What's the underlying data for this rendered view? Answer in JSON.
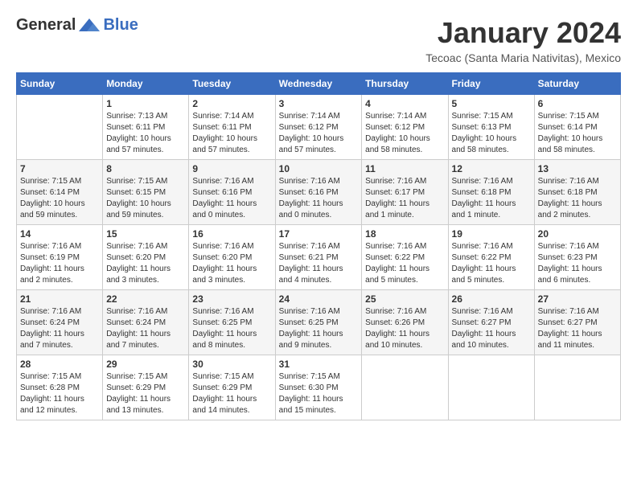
{
  "header": {
    "logo": {
      "general": "General",
      "blue": "Blue"
    },
    "title": "January 2024",
    "location": "Tecoac (Santa Maria Nativitas), Mexico"
  },
  "weekdays": [
    "Sunday",
    "Monday",
    "Tuesday",
    "Wednesday",
    "Thursday",
    "Friday",
    "Saturday"
  ],
  "weeks": [
    [
      {
        "day": "",
        "info": ""
      },
      {
        "day": "1",
        "info": "Sunrise: 7:13 AM\nSunset: 6:11 PM\nDaylight: 10 hours and 57 minutes."
      },
      {
        "day": "2",
        "info": "Sunrise: 7:14 AM\nSunset: 6:11 PM\nDaylight: 10 hours and 57 minutes."
      },
      {
        "day": "3",
        "info": "Sunrise: 7:14 AM\nSunset: 6:12 PM\nDaylight: 10 hours and 57 minutes."
      },
      {
        "day": "4",
        "info": "Sunrise: 7:14 AM\nSunset: 6:12 PM\nDaylight: 10 hours and 58 minutes."
      },
      {
        "day": "5",
        "info": "Sunrise: 7:15 AM\nSunset: 6:13 PM\nDaylight: 10 hours and 58 minutes."
      },
      {
        "day": "6",
        "info": "Sunrise: 7:15 AM\nSunset: 6:14 PM\nDaylight: 10 hours and 58 minutes."
      }
    ],
    [
      {
        "day": "7",
        "info": "Sunrise: 7:15 AM\nSunset: 6:14 PM\nDaylight: 10 hours and 59 minutes."
      },
      {
        "day": "8",
        "info": "Sunrise: 7:15 AM\nSunset: 6:15 PM\nDaylight: 10 hours and 59 minutes."
      },
      {
        "day": "9",
        "info": "Sunrise: 7:16 AM\nSunset: 6:16 PM\nDaylight: 11 hours and 0 minutes."
      },
      {
        "day": "10",
        "info": "Sunrise: 7:16 AM\nSunset: 6:16 PM\nDaylight: 11 hours and 0 minutes."
      },
      {
        "day": "11",
        "info": "Sunrise: 7:16 AM\nSunset: 6:17 PM\nDaylight: 11 hours and 1 minute."
      },
      {
        "day": "12",
        "info": "Sunrise: 7:16 AM\nSunset: 6:18 PM\nDaylight: 11 hours and 1 minute."
      },
      {
        "day": "13",
        "info": "Sunrise: 7:16 AM\nSunset: 6:18 PM\nDaylight: 11 hours and 2 minutes."
      }
    ],
    [
      {
        "day": "14",
        "info": "Sunrise: 7:16 AM\nSunset: 6:19 PM\nDaylight: 11 hours and 2 minutes."
      },
      {
        "day": "15",
        "info": "Sunrise: 7:16 AM\nSunset: 6:20 PM\nDaylight: 11 hours and 3 minutes."
      },
      {
        "day": "16",
        "info": "Sunrise: 7:16 AM\nSunset: 6:20 PM\nDaylight: 11 hours and 3 minutes."
      },
      {
        "day": "17",
        "info": "Sunrise: 7:16 AM\nSunset: 6:21 PM\nDaylight: 11 hours and 4 minutes."
      },
      {
        "day": "18",
        "info": "Sunrise: 7:16 AM\nSunset: 6:22 PM\nDaylight: 11 hours and 5 minutes."
      },
      {
        "day": "19",
        "info": "Sunrise: 7:16 AM\nSunset: 6:22 PM\nDaylight: 11 hours and 5 minutes."
      },
      {
        "day": "20",
        "info": "Sunrise: 7:16 AM\nSunset: 6:23 PM\nDaylight: 11 hours and 6 minutes."
      }
    ],
    [
      {
        "day": "21",
        "info": "Sunrise: 7:16 AM\nSunset: 6:24 PM\nDaylight: 11 hours and 7 minutes."
      },
      {
        "day": "22",
        "info": "Sunrise: 7:16 AM\nSunset: 6:24 PM\nDaylight: 11 hours and 7 minutes."
      },
      {
        "day": "23",
        "info": "Sunrise: 7:16 AM\nSunset: 6:25 PM\nDaylight: 11 hours and 8 minutes."
      },
      {
        "day": "24",
        "info": "Sunrise: 7:16 AM\nSunset: 6:25 PM\nDaylight: 11 hours and 9 minutes."
      },
      {
        "day": "25",
        "info": "Sunrise: 7:16 AM\nSunset: 6:26 PM\nDaylight: 11 hours and 10 minutes."
      },
      {
        "day": "26",
        "info": "Sunrise: 7:16 AM\nSunset: 6:27 PM\nDaylight: 11 hours and 10 minutes."
      },
      {
        "day": "27",
        "info": "Sunrise: 7:16 AM\nSunset: 6:27 PM\nDaylight: 11 hours and 11 minutes."
      }
    ],
    [
      {
        "day": "28",
        "info": "Sunrise: 7:15 AM\nSunset: 6:28 PM\nDaylight: 11 hours and 12 minutes."
      },
      {
        "day": "29",
        "info": "Sunrise: 7:15 AM\nSunset: 6:29 PM\nDaylight: 11 hours and 13 minutes."
      },
      {
        "day": "30",
        "info": "Sunrise: 7:15 AM\nSunset: 6:29 PM\nDaylight: 11 hours and 14 minutes."
      },
      {
        "day": "31",
        "info": "Sunrise: 7:15 AM\nSunset: 6:30 PM\nDaylight: 11 hours and 15 minutes."
      },
      {
        "day": "",
        "info": ""
      },
      {
        "day": "",
        "info": ""
      },
      {
        "day": "",
        "info": ""
      }
    ]
  ]
}
